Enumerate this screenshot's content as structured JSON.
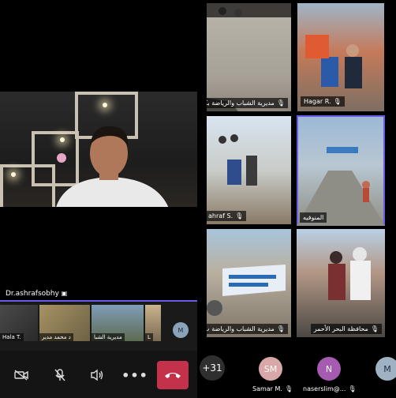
{
  "stage": {
    "speaker_name": "Dr.ashrafsobhy"
  },
  "filmstrip": {
    "items": [
      {
        "label": "Hala T."
      },
      {
        "label": "د محمد مدير"
      },
      {
        "label": "مديرية الشبا"
      },
      {
        "label": "L"
      }
    ],
    "extra_avatar": "M"
  },
  "grid": {
    "tiles": [
      {
        "label": "مديرية الشباب والرياضة بكفر الشي"
      },
      {
        "label": "Hagar R."
      },
      {
        "label": "ahraf S."
      },
      {
        "label": "المنوفيه"
      },
      {
        "label": "مديرية الشباب والرياضة ب"
      },
      {
        "label": "محافظة البحر الأحمر"
      }
    ]
  },
  "participants": {
    "overflow": "+31",
    "people": [
      {
        "initials": "SM",
        "name": "Samar M.",
        "color": "#d8a7a7"
      },
      {
        "initials": "N",
        "name": "naserslim@...",
        "color": "#a45bb0"
      },
      {
        "initials": "M",
        "name": "",
        "color": "#9fb2c4"
      }
    ]
  },
  "colors": {
    "accent": "#6b5ce7",
    "leave": "#c4314b"
  },
  "icons": {
    "camera_off": "camera-off-icon",
    "mic_off": "mic-off-icon",
    "speaker": "speaker-icon",
    "more": "more-icon",
    "leave": "phone-hangup-icon"
  }
}
